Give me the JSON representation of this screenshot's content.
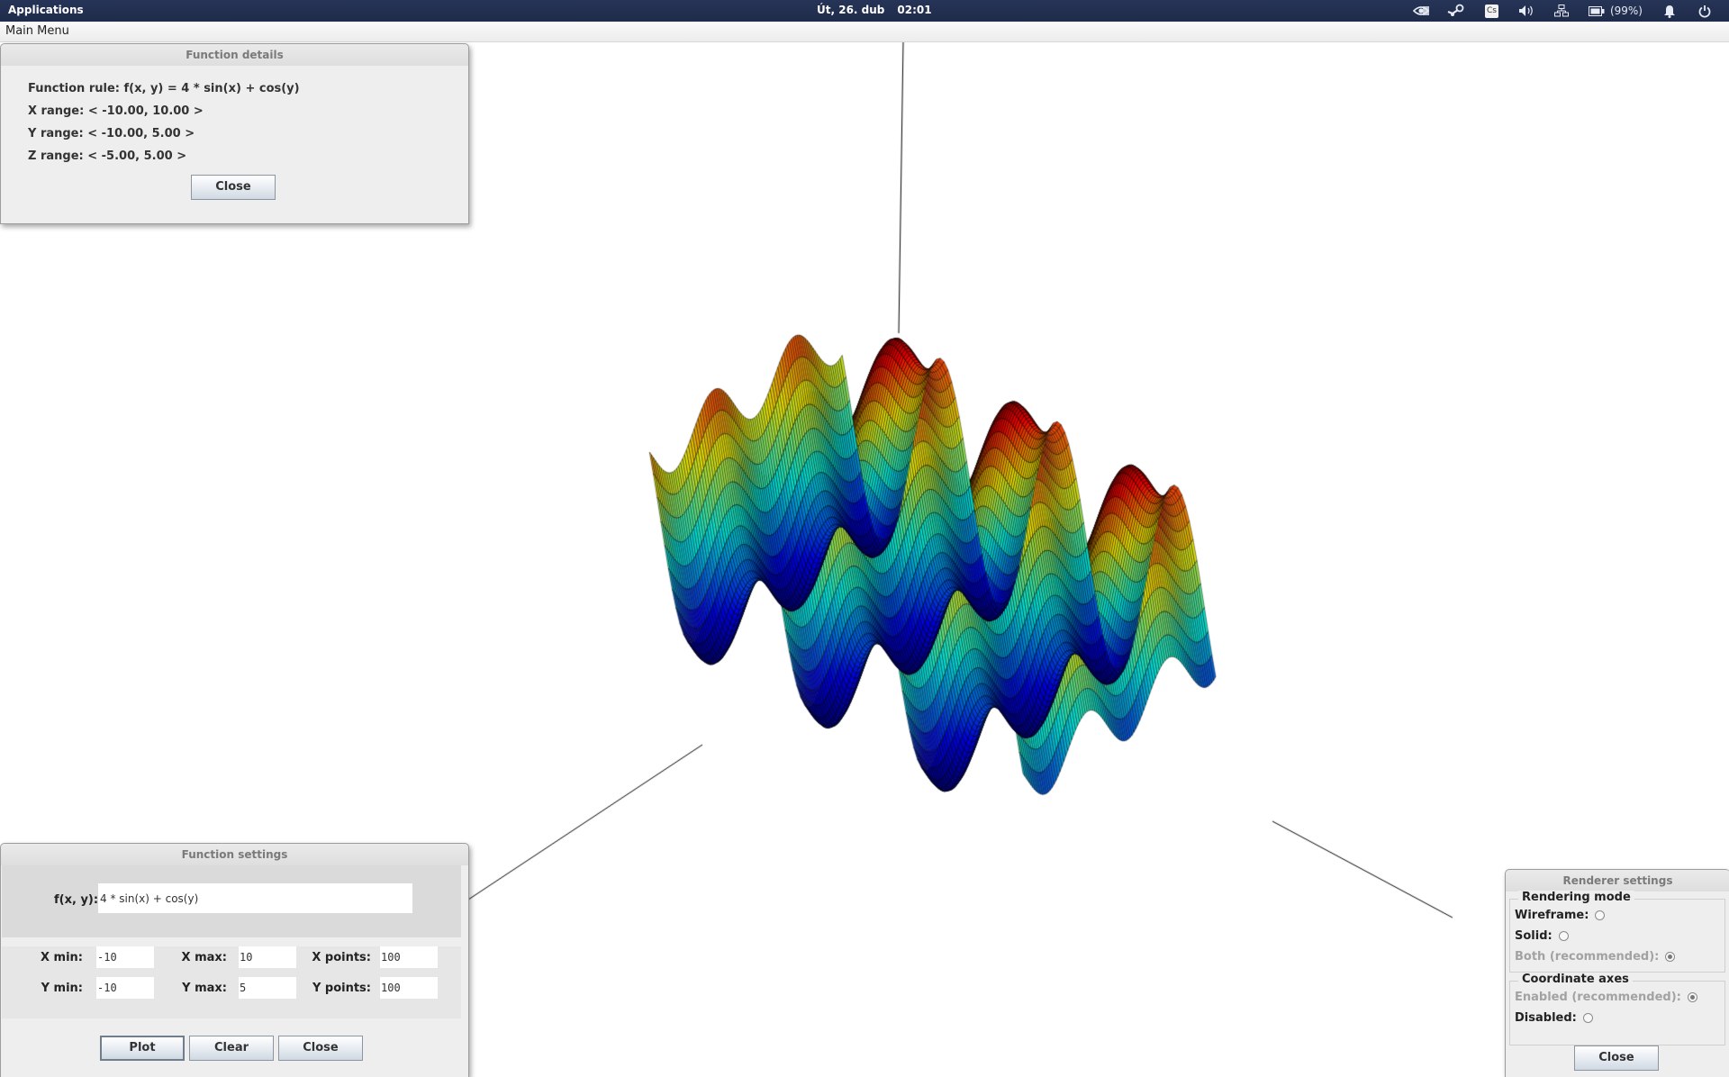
{
  "system_panel": {
    "applications_label": "Applications",
    "date": "Út, 26. dub",
    "time": "02:01",
    "tray": [
      {
        "icon": "nvidia-icon"
      },
      {
        "icon": "steam-icon"
      },
      {
        "icon": "cs-icon",
        "text": "Cs"
      },
      {
        "icon": "volume-icon"
      },
      {
        "icon": "network-icon"
      },
      {
        "icon": "battery-icon",
        "text": "(99%)"
      },
      {
        "icon": "bell-icon"
      },
      {
        "icon": "power-icon"
      }
    ]
  },
  "menubar": {
    "main_menu_label": "Main Menu"
  },
  "function_details": {
    "title": "Function details",
    "function_rule": "Function rule: f(x, y) = 4 * sin(x) + cos(y)",
    "x_range": "X range: < -10.00, 10.00 >",
    "y_range": "Y range: < -10.00, 5.00 >",
    "z_range": "Z range: < -5.00, 5.00 >",
    "close_label": "Close"
  },
  "function_settings": {
    "title": "Function settings",
    "fx_label": "f(x, y):",
    "fx_value": "4 * sin(x) + cos(y)",
    "x_min_label": "X min:",
    "x_min": "-10",
    "x_max_label": "X max:",
    "x_max": "10",
    "x_points_label": "X points:",
    "x_points": "100",
    "y_min_label": "Y min:",
    "y_min": "-10",
    "y_max_label": "Y max:",
    "y_max": "5",
    "y_points_label": "Y points:",
    "y_points": "100",
    "plot_label": "Plot",
    "clear_label": "Clear",
    "close_label": "Close"
  },
  "renderer_settings": {
    "title": "Renderer settings",
    "rendering_mode_title": "Rendering mode",
    "wireframe_label": "Wireframe:",
    "solid_label": "Solid:",
    "both_label": "Both (recommended):",
    "rendering_mode_selected": "both",
    "coordinate_axes_title": "Coordinate axes",
    "enabled_label": "Enabled (recommended):",
    "disabled_label": "Disabled:",
    "axes_selected": "enabled",
    "close_label": "Close"
  },
  "plot": {
    "expression": "4 * sin(x) + cos(y)",
    "x_range": [
      -10,
      10
    ],
    "y_range": [
      -10,
      5
    ],
    "z_range": [
      -5,
      5
    ],
    "x_points": 100,
    "y_points": 100,
    "colormap": "jet",
    "mode": "both",
    "axes": "enabled"
  }
}
